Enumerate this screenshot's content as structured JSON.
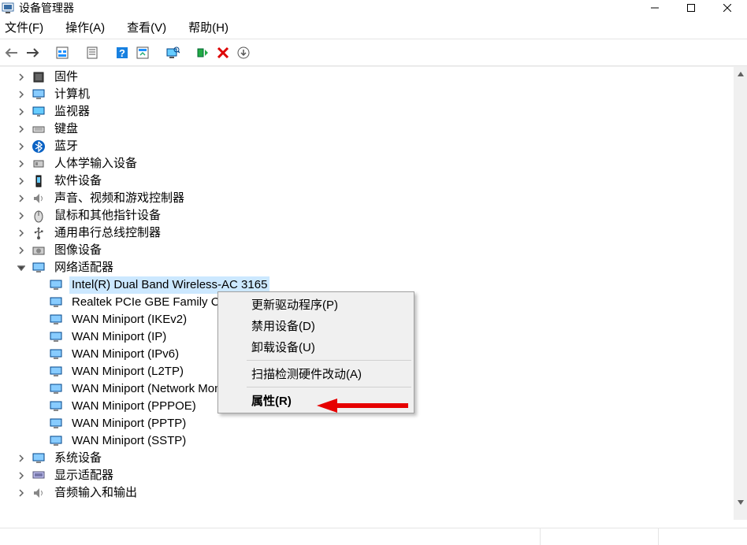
{
  "window": {
    "title": "设备管理器"
  },
  "menu": {
    "file": "文件(F)",
    "action": "操作(A)",
    "view": "查看(V)",
    "help": "帮助(H)"
  },
  "categories": {
    "firmware": "固件",
    "computer": "计算机",
    "monitors": "监视器",
    "keyboards": "键盘",
    "bluetooth": "蓝牙",
    "hid": "人体学输入设备",
    "software_devices": "软件设备",
    "sound": "声音、视频和游戏控制器",
    "mice": "鼠标和其他指针设备",
    "usb": "通用串行总线控制器",
    "imaging": "图像设备",
    "network": "网络适配器",
    "system": "系统设备",
    "display": "显示适配器",
    "audio_io": "音频输入和输出"
  },
  "network_adapters": [
    "Intel(R) Dual Band Wireless-AC 3165",
    "Realtek PCIe GBE Family Controller",
    "WAN Miniport (IKEv2)",
    "WAN Miniport (IP)",
    "WAN Miniport (IPv6)",
    "WAN Miniport (L2TP)",
    "WAN Miniport (Network Monitor)",
    "WAN Miniport (PPPOE)",
    "WAN Miniport (PPTP)",
    "WAN Miniport (SSTP)"
  ],
  "context_menu": {
    "update_driver": "更新驱动程序(P)",
    "disable_device": "禁用设备(D)",
    "uninstall_device": "卸载设备(U)",
    "scan_hardware": "扫描检测硬件改动(A)",
    "properties": "属性(R)"
  }
}
